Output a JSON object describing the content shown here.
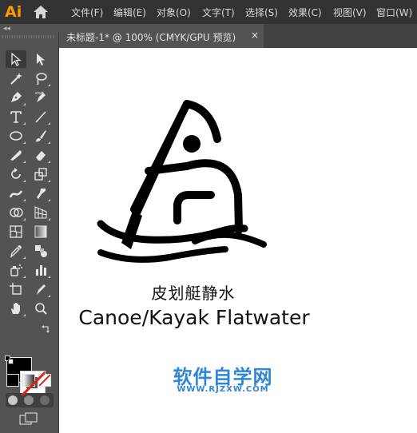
{
  "app": {
    "logo": "Ai",
    "home_icon": "home-icon"
  },
  "menu": {
    "items": [
      "文件(F)",
      "编辑(E)",
      "对象(O)",
      "文字(T)",
      "选择(S)",
      "效果(C)",
      "视图(V)",
      "窗口(W)"
    ]
  },
  "panel": {
    "collapse_label": "◂◂"
  },
  "document_tab": {
    "label": "未标题-1* @ 100% (CMYK/GPU 预览)",
    "close": "×"
  },
  "toolbar": {
    "tools": [
      "selection-tool",
      "direct-selection-tool",
      "magic-wand-tool",
      "lasso-tool",
      "pen-tool",
      "curvature-tool",
      "type-tool",
      "line-segment-tool",
      "ellipse-tool",
      "paintbrush-tool",
      "shaper-tool",
      "eraser-tool",
      "rotate-tool",
      "scale-tool",
      "width-tool",
      "puppet-warp-tool",
      "shape-builder-tool",
      "perspective-grid-tool",
      "mesh-tool",
      "gradient-tool",
      "eyedropper-tool",
      "blend-tool",
      "symbol-sprayer-tool",
      "column-graph-tool",
      "artboard-tool",
      "slice-tool",
      "hand-tool",
      "zoom-tool"
    ],
    "fill_color": "#000000",
    "stroke_color": "none"
  },
  "canvas": {
    "caption_cn": "皮划艇静水",
    "caption_en": "Canoe/Kayak Flatwater",
    "watermark_title": "软件自学网",
    "watermark_url": "WWW.RJZXW.COM",
    "watermark_color": "#2f86d6"
  }
}
